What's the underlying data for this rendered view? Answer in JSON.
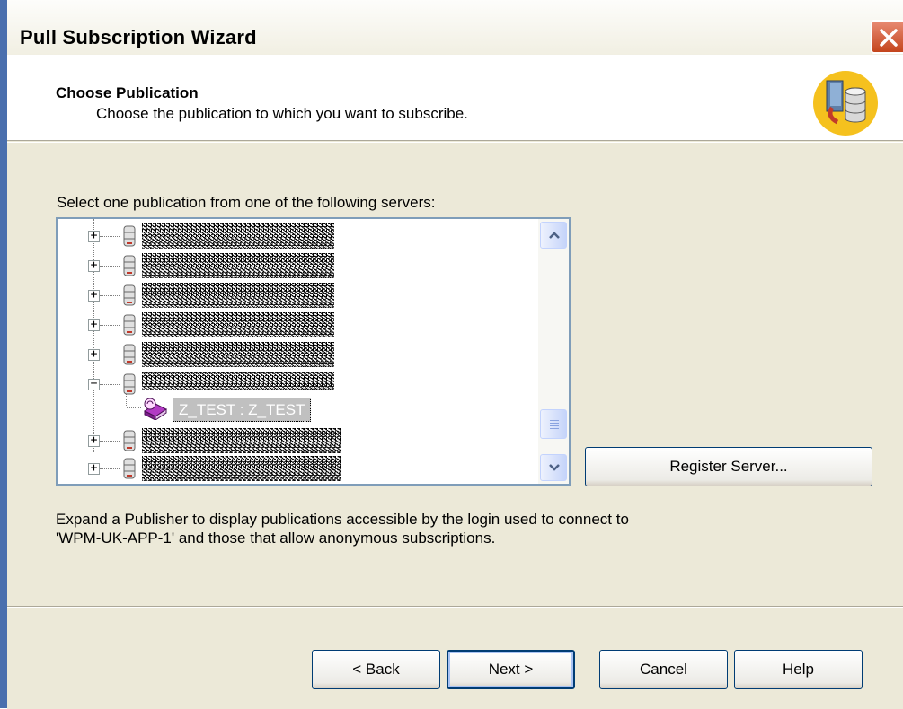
{
  "window": {
    "title": "Pull Subscription Wizard",
    "close_label": "Close"
  },
  "header": {
    "title": "Choose Publication",
    "subtitle": "Choose the publication to which you want to subscribe.",
    "icon": "publication-database-icon"
  },
  "main": {
    "select_label": "Select one publication from one of the following servers:",
    "tree": {
      "publication_label": "Z_TEST : Z_TEST",
      "publication_icon": "publication-book-icon",
      "server_icon": "database-server-icon"
    },
    "register_server_label": "Register Server...",
    "description_line1": "Expand a Publisher to display publications accessible by the login used to connect to",
    "description_line2": "'WPM-UK-APP-1' and those that allow anonymous subscriptions."
  },
  "footer": {
    "back_label": "< Back",
    "next_label": "Next >",
    "cancel_label": "Cancel",
    "help_label": "Help"
  },
  "colors": {
    "accent": "#ece9d8",
    "selection": "#c0c0c0",
    "close_button": "#c4451c"
  }
}
